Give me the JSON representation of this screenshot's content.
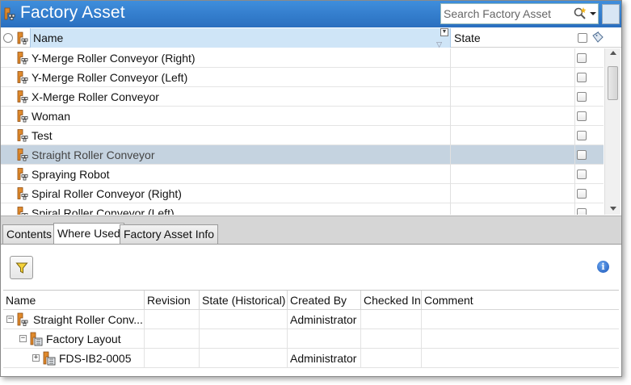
{
  "window": {
    "title": "Factory Asset",
    "search": {
      "placeholder": "Search Factory Asset",
      "value": ""
    }
  },
  "top_table": {
    "columns": {
      "name": "Name",
      "state": "State"
    },
    "rows": [
      {
        "name": "Y-Merge Roller Conveyor (Right)",
        "state": "",
        "selected": false
      },
      {
        "name": "Y-Merge Roller Conveyor (Left)",
        "state": "",
        "selected": false
      },
      {
        "name": "X-Merge Roller Conveyor",
        "state": "",
        "selected": false
      },
      {
        "name": "Woman",
        "state": "",
        "selected": false
      },
      {
        "name": "Test",
        "state": "",
        "selected": false
      },
      {
        "name": "Straight Roller Conveyor",
        "state": "",
        "selected": true
      },
      {
        "name": "Spraying Robot",
        "state": "",
        "selected": false
      },
      {
        "name": "Spiral Roller Conveyor (Right)",
        "state": "",
        "selected": false
      },
      {
        "name": "Spiral Roller Conveyor (Left)",
        "state": "",
        "selected": false
      }
    ]
  },
  "tabs": [
    {
      "label": "Contents",
      "active": false
    },
    {
      "label": "Where Used",
      "active": true
    },
    {
      "label": "Factory Asset Info",
      "active": false
    }
  ],
  "where_used": {
    "columns": {
      "name": "Name",
      "revision": "Revision",
      "state_historical": "State (Historical)",
      "created_by": "Created By",
      "checked_in": "Checked In",
      "comment": "Comment"
    },
    "rows": [
      {
        "name": "Straight Roller Conv...",
        "revision": "",
        "state": "",
        "created_by": "Administrator",
        "checked_in": "",
        "comment": "",
        "expander": "−"
      },
      {
        "name": "Factory Layout",
        "revision": "",
        "state": "",
        "created_by": "",
        "checked_in": "",
        "comment": "",
        "expander": "−"
      },
      {
        "name": "FDS-IB2-0005",
        "revision": "",
        "state": "",
        "created_by": "Administrator",
        "checked_in": "",
        "comment": "",
        "expander": "+"
      }
    ]
  },
  "icons": {
    "asset": "factory-asset-icon",
    "layout": "factory-layout-icon",
    "filter": "filter-icon",
    "info": "info-icon",
    "search": "search-icon",
    "tag": "tag-icon"
  },
  "colors": {
    "title_bar": "#2f7bd0",
    "selected_row": "#c5d3e0",
    "name_header": "#cfe5f7",
    "icon_orange": "#d9822b"
  }
}
